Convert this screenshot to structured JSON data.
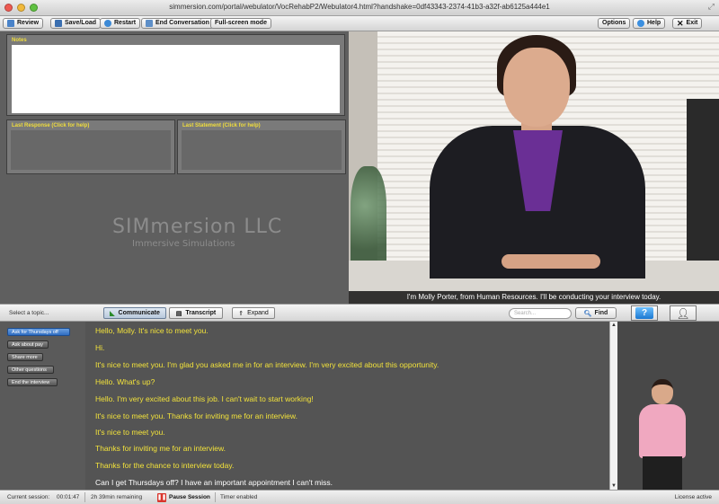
{
  "window": {
    "url": "simmersion.com/portal/webulator/VocRehabP2/Webulator4.html?handshake=0df43343-2374-41b3-a32f-ab6125a444e1"
  },
  "toolbar": {
    "review": "Review",
    "save_load": "Save/Load",
    "restart": "Restart",
    "end_conversation": "End Conversation",
    "fullscreen": "Full-screen mode",
    "options": "Options",
    "help": "Help",
    "exit": "Exit"
  },
  "panels": {
    "notes_title": "Notes",
    "last_response_title": "Last Response (Click for help)",
    "last_statement_title": "Last Statement (Click for help)"
  },
  "logo": {
    "line1": "SIMmersion LLC",
    "line2": "Immersive Simulations"
  },
  "video": {
    "caption": "I'm Molly Porter, from Human Resources. I'll be conducting your interview today."
  },
  "controls": {
    "select_topic": "Select a topic...",
    "communicate": "Communicate",
    "transcript": "Transcript",
    "expand": "Expand",
    "search_placeholder": "Search...",
    "find": "Find"
  },
  "topics": [
    {
      "label": "Ask for Thursdays off"
    },
    {
      "label": "Ask about pay"
    },
    {
      "label": "Share more"
    },
    {
      "label": "Other questions"
    },
    {
      "label": "End the interview"
    }
  ],
  "responses": [
    {
      "text": "Hello, Molly. It's nice to meet you.",
      "color": "#f2e23b"
    },
    {
      "text": "Hi.",
      "color": "#f2e23b"
    },
    {
      "text": "It's nice to meet you. I'm glad you asked me in for an interview. I'm very excited about this opportunity.",
      "color": "#f2e23b"
    },
    {
      "text": "Hello. What's up?",
      "color": "#f2e23b"
    },
    {
      "text": "Hello. I'm very excited about this job. I can't wait to start working!",
      "color": "#f2e23b"
    },
    {
      "text": "It's nice to meet you. Thanks for inviting me for an interview.",
      "color": "#f2e23b"
    },
    {
      "text": "It's nice to meet you.",
      "color": "#f2e23b"
    },
    {
      "text": "Thanks for inviting me for an interview.",
      "color": "#f2e23b"
    },
    {
      "text": "Thanks for the chance to interview today.",
      "color": "#f2e23b"
    },
    {
      "text": "Can I get Thursdays off? I have an important appointment I can't miss.",
      "color": "#ffffff"
    }
  ],
  "status": {
    "current_session_label": "Current session:",
    "current_session_time": "00:01:47",
    "remaining": "2h 39min remaining",
    "pause": "Pause Session",
    "timer": "Timer enabled",
    "license": "License active"
  },
  "colors": {
    "accent_yellow": "#f2e23b",
    "topic_active": "#3f7fd4",
    "panel_bg": "#5f5f5f"
  }
}
